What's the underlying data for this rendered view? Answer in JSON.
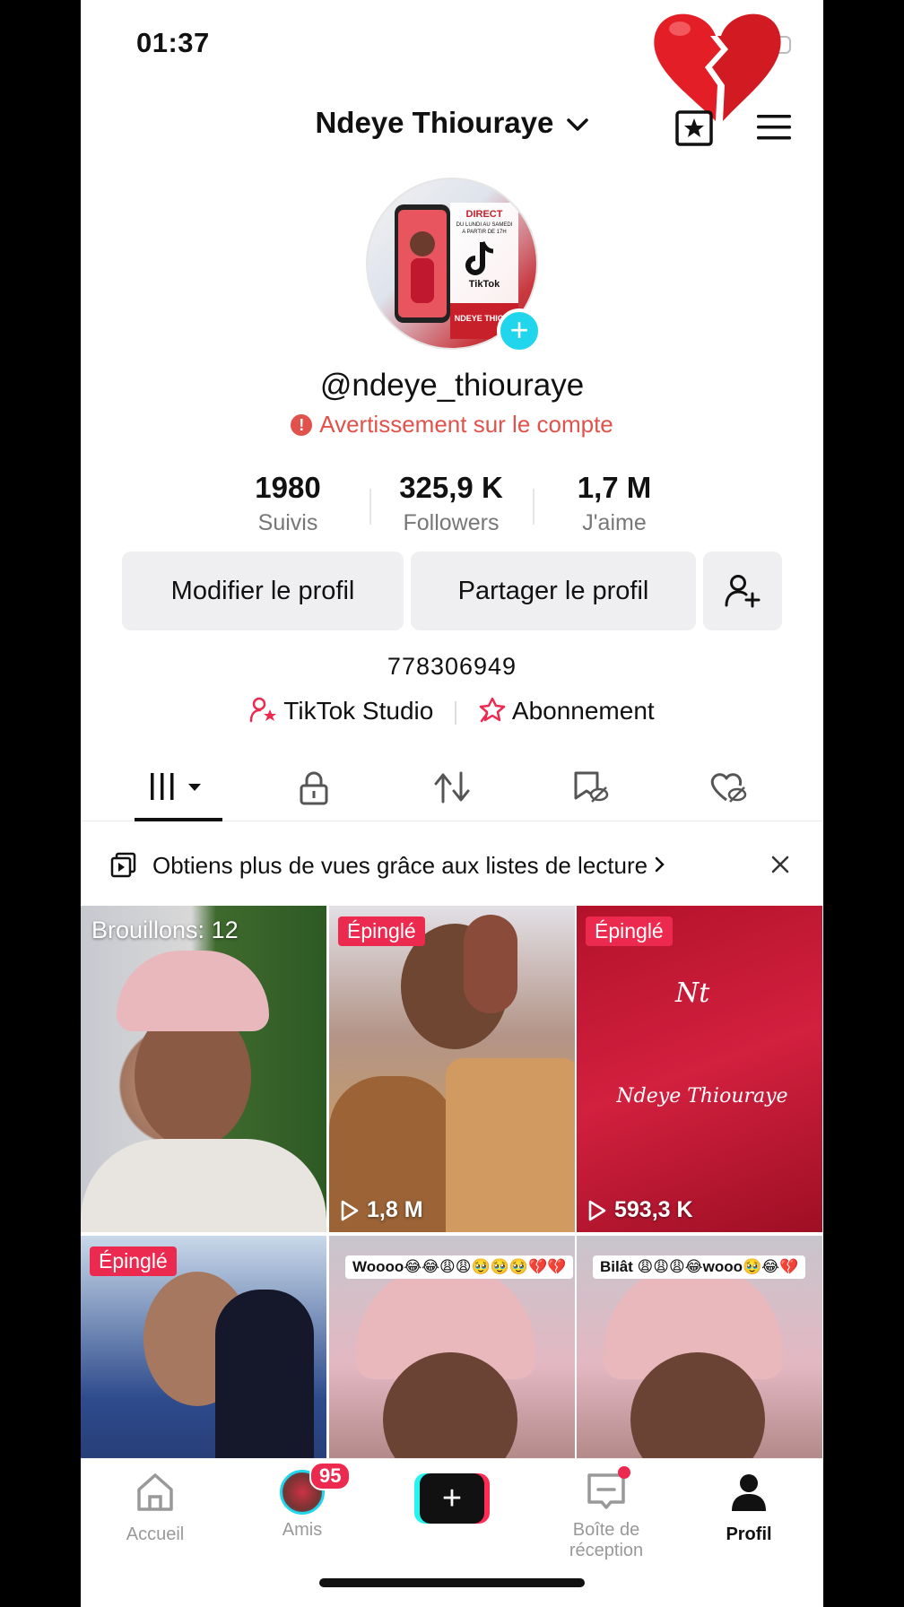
{
  "status_bar": {
    "time": "01:37"
  },
  "header": {
    "display_name": "Ndeye Thiouraye"
  },
  "profile": {
    "handle": "@ndeye_thiouraye",
    "warning": "Avertissement sur le compte",
    "avatar_text": {
      "top": "DIRECT",
      "line2": "DU LUNDI AU SAMEDI",
      "line3": "A PARTIR DE 17H",
      "brand": "TikTok",
      "bottom": "NDEYE THIOURA"
    }
  },
  "stats": [
    {
      "value": "1980",
      "label": "Suivis"
    },
    {
      "value": "325,9 K",
      "label": "Followers"
    },
    {
      "value": "1,7 M",
      "label": "J'aime"
    }
  ],
  "buttons": {
    "edit": "Modifier le profil",
    "share": "Partager le profil"
  },
  "bio": "778306949",
  "links": {
    "studio": "TikTok Studio",
    "subscription": "Abonnement"
  },
  "playlist_banner": {
    "text": "Obtiens plus de vues grâce aux listes de lecture"
  },
  "videos": [
    {
      "overlay": "Brouillons: 12"
    },
    {
      "pin": "Épinglé",
      "views": "1,8 M"
    },
    {
      "pin": "Épinglé",
      "views": "593,3 K",
      "watermark": "Ndeye Thiouraye",
      "monogram": "Nt"
    },
    {
      "pin": "Épinglé"
    },
    {
      "caption": "Woooo😂😂😩😩🥹🥹🥹💔💔"
    },
    {
      "caption": "Bilât 😩😩😩😂wooo🥹😂💔"
    }
  ],
  "bottom_nav": {
    "home": "Accueil",
    "friends": "Amis",
    "friends_badge": "95",
    "inbox": "Boîte de réception",
    "profile": "Profil"
  },
  "colors": {
    "accent_pink": "#ec2a50",
    "accent_cyan": "#20d5ec",
    "warning_red": "#e0524b"
  }
}
